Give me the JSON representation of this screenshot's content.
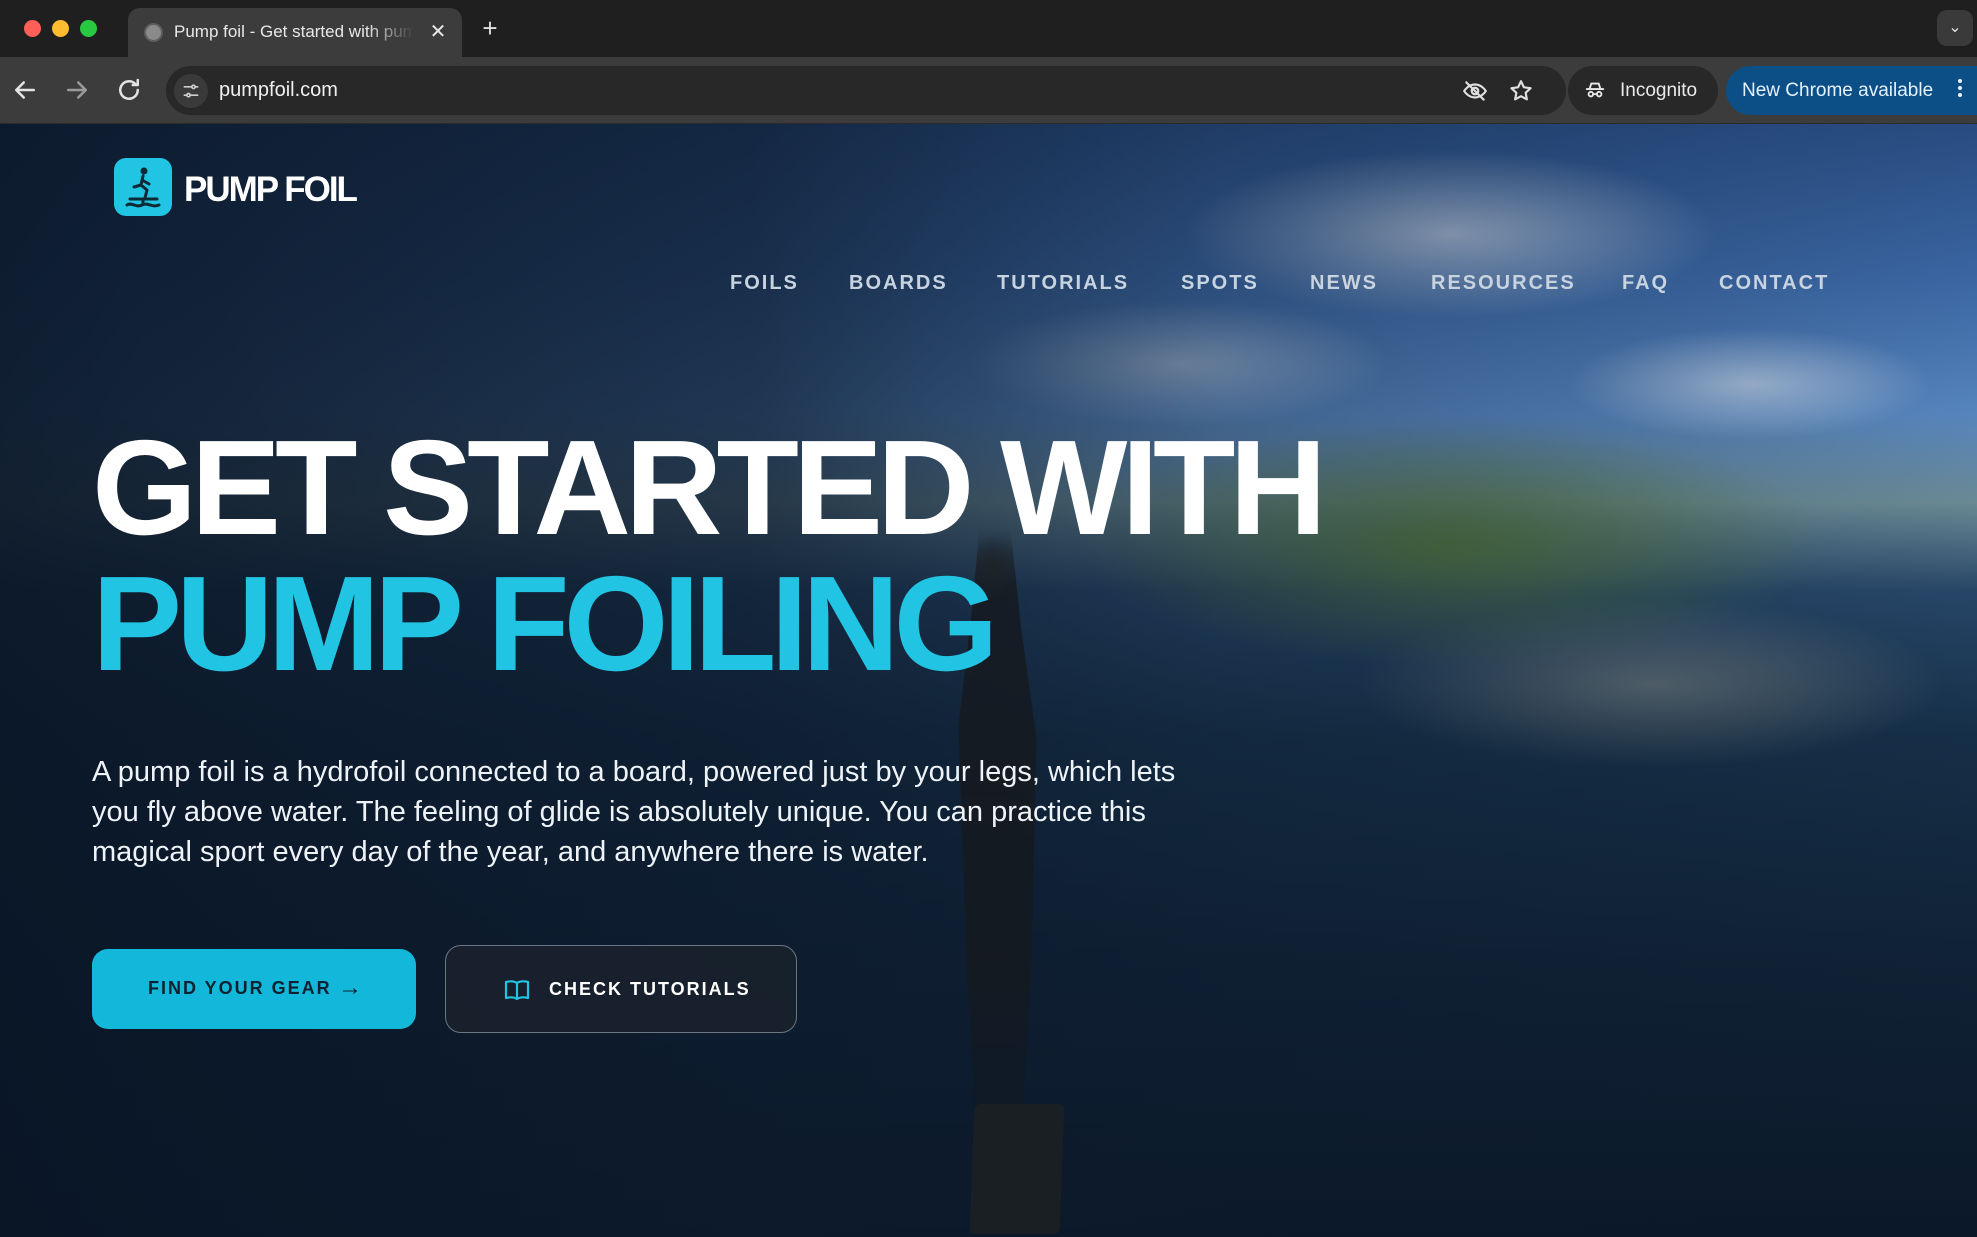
{
  "browser": {
    "tab_title": "Pump foil - Get started with pump foiling",
    "tab_close": "✕",
    "new_tab": "+",
    "url": "pumpfoil.com",
    "incognito_label": "Incognito",
    "update_label": "New Chrome available"
  },
  "site": {
    "logo_text": "PUMP FOIL",
    "nav": [
      "FOILS",
      "BOARDS",
      "TUTORIALS",
      "SPOTS",
      "NEWS",
      "RESOURCES",
      "FAQ",
      "CONTACT"
    ]
  },
  "hero": {
    "title_line1": "GET STARTED WITH",
    "title_line2": "PUMP FOILING",
    "description": "A pump foil is a hydrofoil connected to a board, powered just by your legs, which lets you fly above water. The feeling of glide is absolutely unique. You can practice this magical sport every day of the year, and anywhere there is water.",
    "primary_button": "FIND YOUR GEAR",
    "primary_arrow": "→",
    "secondary_button": "CHECK TUTORIALS"
  },
  "colors": {
    "accent": "#22c4e4",
    "primary_button_bg": "#13b7d9",
    "update_chip_bg": "#0b4f86"
  }
}
